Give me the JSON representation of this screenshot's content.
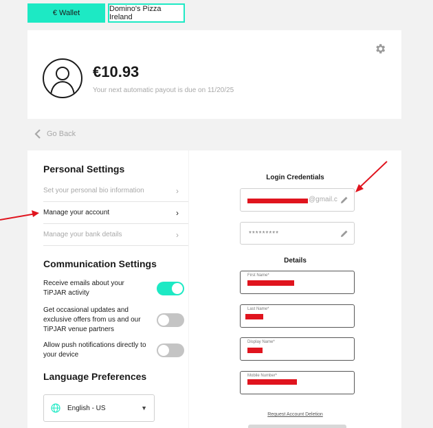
{
  "tabs": {
    "wallet": "€ Wallet",
    "venue": "Domino's Pizza Ireland"
  },
  "wallet": {
    "balance": "€10.93",
    "payout_note": "Your next automatic payout is due on 11/20/25"
  },
  "nav": {
    "go_back": "Go Back"
  },
  "personal": {
    "title": "Personal Settings",
    "items": [
      {
        "label": "Set your personal bio information"
      },
      {
        "label": "Manage your account"
      },
      {
        "label": "Manage your bank details"
      }
    ]
  },
  "communication": {
    "title": "Communication Settings",
    "toggles": [
      {
        "label": "Receive emails about your TiPJAR activity",
        "on": true
      },
      {
        "label": "Get occasional updates and exclusive offers from us and our TiPJAR venue partners",
        "on": false
      },
      {
        "label": "Allow push notifications directly to your device",
        "on": false
      }
    ]
  },
  "language": {
    "title": "Language Preferences",
    "selected": "English - US"
  },
  "credentials": {
    "title": "Login Credentials",
    "email_suffix": "@gmail.c",
    "password_mask": "*********"
  },
  "details": {
    "title": "Details",
    "first_name_label": "First Name*",
    "last_name_label": "Last Name*",
    "display_name_label": "Display Name*",
    "mobile_label": "Mobile Number*"
  },
  "request_deletion": "Request Account Deletion",
  "colors": {
    "accent": "#1de9c4",
    "annotation": "#e0141e"
  }
}
